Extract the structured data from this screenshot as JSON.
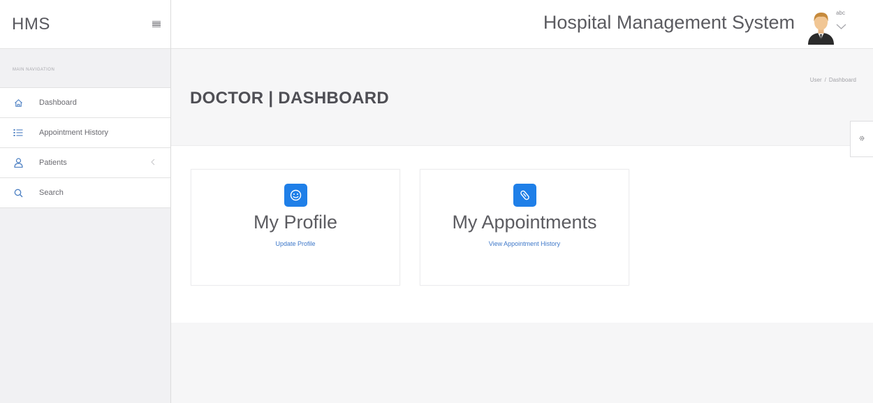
{
  "brand": {
    "title": "HMS"
  },
  "sidebar": {
    "header": "MAIN NAVIGATION",
    "items": [
      {
        "label": "Dashboard",
        "icon": "home-icon"
      },
      {
        "label": "Appointment History",
        "icon": "list-icon"
      },
      {
        "label": "Patients",
        "icon": "user-icon"
      },
      {
        "label": "Search",
        "icon": "search-icon"
      }
    ]
  },
  "header": {
    "title": "Hospital Management System",
    "user_name": "abc"
  },
  "page": {
    "title": "DOCTOR | DASHBOARD",
    "breadcrumb": [
      "User",
      "Dashboard"
    ]
  },
  "cards": [
    {
      "title": "My Profile",
      "link": "Update Profile",
      "icon": "smile-icon"
    },
    {
      "title": "My Appointments",
      "link": "View Appointment History",
      "icon": "paperclip-icon"
    }
  ],
  "colors": {
    "accent": "#1f7fe8",
    "link": "#3e78c9",
    "nav_icon": "#4a7ec2"
  }
}
